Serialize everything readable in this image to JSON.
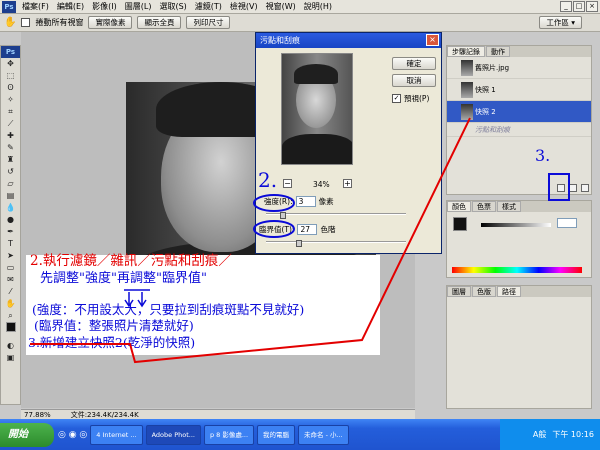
{
  "menu": {
    "items": [
      "檔案(F)",
      "編輯(E)",
      "影像(I)",
      "圖層(L)",
      "選取(S)",
      "濾鏡(T)",
      "檢視(V)",
      "視窗(W)",
      "說明(H)"
    ]
  },
  "options": {
    "scroll_all": "捲動所有視窗",
    "actual_pixels": "實際像素",
    "fit_screen": "顯示全頁",
    "print_size": "列印尺寸",
    "workspace": "工作區"
  },
  "dialog": {
    "title": "污點和刮痕",
    "ok": "確定",
    "cancel": "取消",
    "preview": "預視(P)",
    "zoom": "34%",
    "radius_label": "強度(R):",
    "radius_value": "3",
    "radius_unit": "像素",
    "threshold_label": "臨界值(T):",
    "threshold_value": "27",
    "threshold_unit": "色階"
  },
  "history": {
    "tabs": [
      "步驟記錄",
      "動作"
    ],
    "rows": [
      {
        "label": "舊照片.jpg"
      },
      {
        "label": "快照 1"
      },
      {
        "label": "快照 2"
      },
      {
        "label": "污點和刮痕"
      }
    ]
  },
  "color_panel": {
    "tabs": [
      "顏色",
      "色票",
      "樣式"
    ]
  },
  "layers_panel": {
    "tabs": [
      "圖層",
      "色版",
      "路徑"
    ]
  },
  "status": {
    "zoom": "77.88%",
    "doc": "文件:234.4K/234.4K"
  },
  "annotations": {
    "step2_num": "2.",
    "step3_num": "3.",
    "line1": "2.執行濾鏡／雜訊／污點和刮痕／",
    "line2": "先調整\"強度\"再調整\"臨界值\"",
    "line3": "(強度：不用設太大，只要拉到刮痕斑點不見就好)",
    "line4": "(臨界值：整張照片清楚就好)",
    "line5": "3.新增建立快照2(乾淨的快照)"
  },
  "taskbar": {
    "start": "開始",
    "tasks": [
      "4 Internet ...",
      "Adobe Phot...",
      "p 8 影像處...",
      "我的電腦",
      "未命名 - 小..."
    ],
    "ime": "A般",
    "time": "下午 10:16"
  },
  "colors": {
    "annotation_blue": "#0b0bd8",
    "annotation_red": "#e30000",
    "selection": "#3159c5"
  }
}
